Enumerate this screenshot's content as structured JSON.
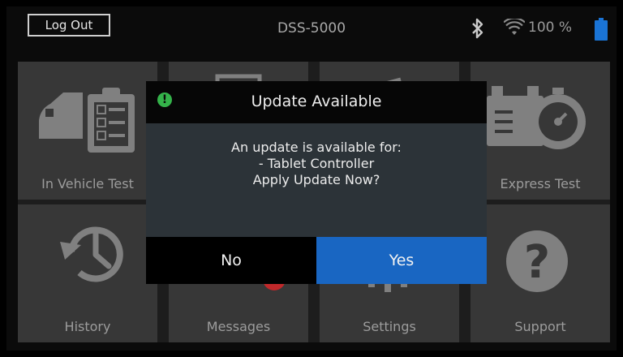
{
  "status_bar": {
    "logout_label": "Log Out",
    "device_model": "DSS-5000",
    "battery_percent": "100 %",
    "icons": [
      "bluetooth-icon",
      "wifi-icon",
      "battery-icon"
    ],
    "battery_color": "#1a74d6"
  },
  "tiles": [
    {
      "label": "In Vehicle Test",
      "icon": "car-checklist-icon"
    },
    {
      "label": "",
      "icon": "device-icon"
    },
    {
      "label": "",
      "icon": "tool-icon"
    },
    {
      "label": "Express Test",
      "icon": "battery-stopwatch-icon"
    },
    {
      "label": "History",
      "icon": "history-icon"
    },
    {
      "label": "Messages",
      "icon": "messages-icon"
    },
    {
      "label": "Settings",
      "icon": "settings-icon"
    },
    {
      "label": "Support",
      "icon": "help-icon"
    }
  ],
  "dialog": {
    "title": "Update Available",
    "message_line1": "An update is available for:",
    "message_line2": "- Tablet Controller",
    "message_line3": "Apply Update Now?",
    "no_label": "No",
    "yes_label": "Yes",
    "accent_color": "#1966c2",
    "alert_color": "#34b34a"
  }
}
